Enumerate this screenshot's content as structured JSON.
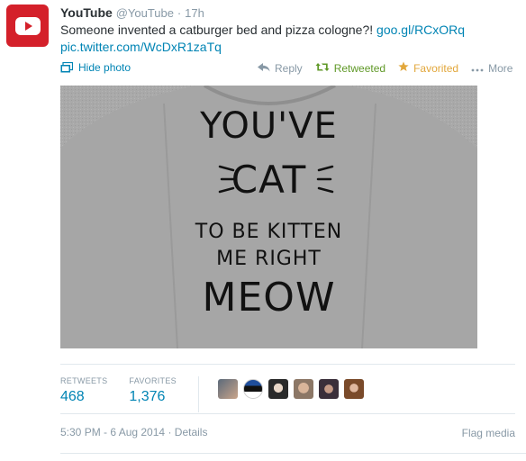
{
  "tweet": {
    "author_name": "YouTube",
    "screen_name": "@YouTube",
    "separator": "·",
    "time_ago": "17h",
    "text": "Someone invented a catburger bed and pizza cologne?!",
    "link1": "goo.gl/RCxORq",
    "link2": "pic.twitter.com/WcDxR1zaTq"
  },
  "media_toggle": {
    "label": "Hide photo",
    "icon": "photo-icon"
  },
  "actions": {
    "reply": {
      "label": "Reply",
      "icon": "reply-icon"
    },
    "retweet": {
      "label": "Retweeted",
      "icon": "retweet-icon"
    },
    "favorite": {
      "label": "Favorited",
      "icon": "star-icon"
    },
    "more": {
      "label": "More",
      "icon": "more-icon"
    }
  },
  "photo": {
    "lines": [
      "YOU'VE",
      "CAT",
      "TO BE KITTEN",
      "ME RIGHT",
      "MEOW"
    ]
  },
  "stats": {
    "retweets_label": "RETWEETS",
    "retweets_value": "468",
    "favorites_label": "FAVORITES",
    "favorites_value": "1,376"
  },
  "footer": {
    "timestamp": "5:30 PM - 6 Aug 2014",
    "dot": "·",
    "details": "Details",
    "flag": "Flag media"
  },
  "colors": {
    "link": "#0084b4",
    "retweeted": "#609928",
    "favorited": "#e2a73b",
    "muted": "#8899a6",
    "brand": "#d4202a"
  }
}
